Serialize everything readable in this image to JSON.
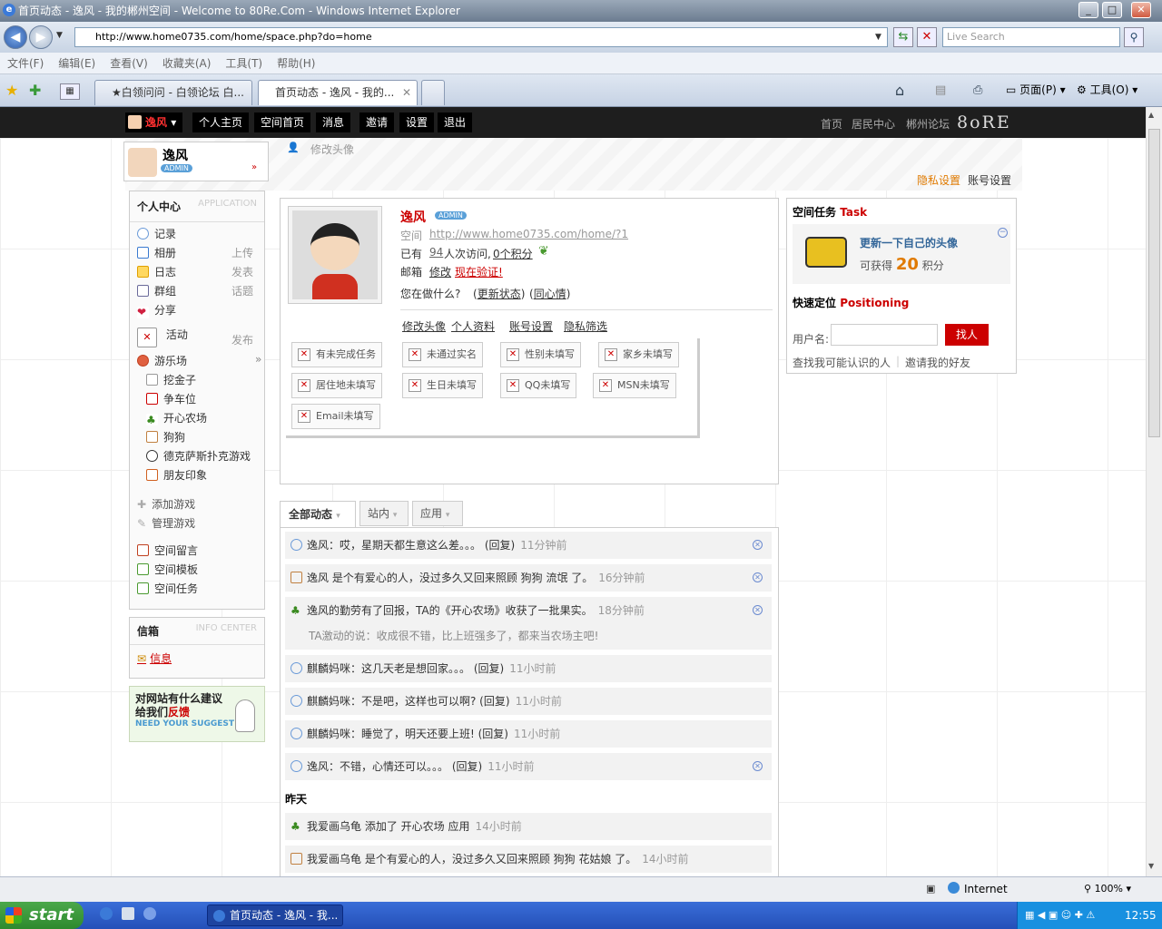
{
  "window": {
    "title": "首页动态 - 逸风 - 我的郴州空间 - Welcome to 80Re.Com - Windows Internet Explorer"
  },
  "address": {
    "url": "http://www.home0735.com/home/space.php?do=home",
    "search_placeholder": "Live Search"
  },
  "menu": [
    "文件(F)",
    "编辑(E)",
    "查看(V)",
    "收藏夹(A)",
    "工具(T)",
    "帮助(H)"
  ],
  "tabs": [
    {
      "label": "★白领问问 - 白领论坛 白..."
    },
    {
      "label": "首页动态 - 逸风 - 我的..."
    }
  ],
  "toolbar": {
    "page": "页面(P)",
    "tools": "工具(O)"
  },
  "sitenav": {
    "username": "逸风",
    "items": [
      "个人主页",
      "空间首页",
      "消息",
      "邀请",
      "设置",
      "退出"
    ],
    "right": [
      "首页",
      "居民中心",
      "郴州论坛"
    ],
    "logo": "8oRE"
  },
  "profile_head": {
    "name": "逸风",
    "badge": "ADMIN",
    "change_avatar": "修改头像",
    "privacy": "隐私设置",
    "account": "账号设置"
  },
  "sidebar": {
    "title": "个人中心",
    "title_en": "APPLICATION",
    "items": [
      {
        "label": "记录",
        "action": ""
      },
      {
        "label": "相册",
        "action": "上传"
      },
      {
        "label": "日志",
        "action": "发表"
      },
      {
        "label": "群组",
        "action": "话题"
      },
      {
        "label": "分享",
        "action": ""
      },
      {
        "label": "活动",
        "action": "发布"
      },
      {
        "label": "游乐场",
        "action": ""
      }
    ],
    "games": [
      "挖金子",
      "争车位",
      "开心农场",
      "狗狗",
      "德克萨斯扑克游戏",
      "朋友印象"
    ],
    "manage": [
      "添加游戏",
      "管理游戏"
    ],
    "space": [
      "空间留言",
      "空间模板",
      "空间任务"
    ],
    "inbox_title": "信箱",
    "inbox_en": "INFO CENTER",
    "inbox_item": "信息",
    "suggest": {
      "line1": "对网站有什么建议",
      "line2a": "给我们",
      "line2b": "反馈",
      "line3": "NEED YOUR SUGGEST"
    }
  },
  "profile": {
    "name": "逸风",
    "badge": "ADMIN",
    "space_label": "空间",
    "space_url": "http://www.home0735.com/home/?1",
    "has_label": "已有",
    "visits": "94",
    "visits_text": "人次访问,",
    "points": "0个积分",
    "email_label": "邮箱",
    "email_change": "修改",
    "email_verify": "现在验证!",
    "doing": "您在做什么?",
    "update_status": "更新状态",
    "same_mood": "同心情",
    "links": [
      "修改头像",
      "个人资料",
      "账号设置",
      "隐私筛选"
    ],
    "tags": [
      "有未完成任务",
      "未通过实名",
      "性别未填写",
      "家乡未填写",
      "居住地未填写",
      "生日未填写",
      "QQ未填写",
      "MSN未填写",
      "Email未填写"
    ]
  },
  "feed_tabs": [
    "全部动态",
    "站内",
    "应用"
  ],
  "feed": [
    {
      "text": "逸风：哎，星期天都生意这么差。。。 (回复)",
      "time": "11分钟前"
    },
    {
      "text": "逸风 是个有爱心的人，没过多久又回来照顾 狗狗 流氓 了。",
      "time": "16分钟前"
    },
    {
      "text": "逸风的勤劳有了回报，TA的《开心农场》收获了一批果实。",
      "time": "18分钟前",
      "extra": "TA激动的说：收成很不错，比上班强多了，都来当农场主吧!"
    },
    {
      "text": "麒麟妈咪：这几天老是想回家。。。 (回复)",
      "time": "11小时前"
    },
    {
      "text": "麒麟妈咪：不是吧，这样也可以啊? (回复)",
      "time": "11小时前"
    },
    {
      "text": "麒麟妈咪：睡觉了，明天还要上班! (回复)",
      "time": "11小时前"
    },
    {
      "text": "逸风：不错，心情还可以。。。 (回复)",
      "time": "11小时前"
    }
  ],
  "yesterday": "昨天",
  "feed_yesterday": [
    {
      "text": "我爱画乌龟 添加了 开心农场 应用",
      "time": "14小时前"
    },
    {
      "text": "我爱画乌龟 是个有爱心的人，没过多久又回来照顾 狗狗 花姑娘 了。",
      "time": "14小时前"
    }
  ],
  "task": {
    "title": "空间任务",
    "title_en": "Task",
    "name": "更新一下自己的头像",
    "reward_pre": "可获得",
    "reward": "20",
    "reward_post": "积分"
  },
  "locate": {
    "title": "快速定位",
    "title_en": "Positioning",
    "label": "用户名:",
    "button": "找人",
    "link1": "查找我可能认识的人",
    "link2": "邀请我的好友"
  },
  "status": {
    "zone": "Internet",
    "zoom": "100%"
  },
  "taskbar": {
    "start": "start",
    "window": "首页动态 - 逸风 - 我...",
    "clock": "12:55"
  },
  "colors": {
    "accent": "#cc0000",
    "nav": "#1e1e1e",
    "link": "#336699"
  }
}
